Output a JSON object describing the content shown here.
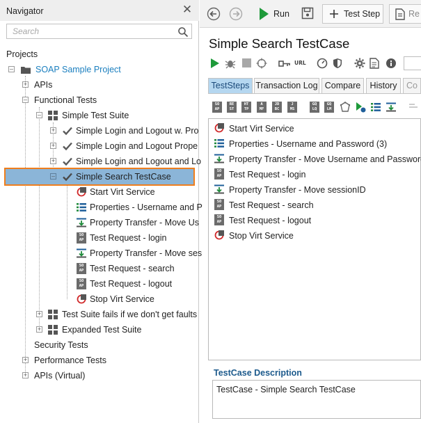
{
  "navigator": {
    "title": "Navigator",
    "search_placeholder": "Search",
    "projects_label": "Projects",
    "tree": [
      {
        "label": "SOAP Sample Project"
      },
      {
        "label": "APIs"
      },
      {
        "label": "Functional Tests"
      },
      {
        "label": "Simple Test Suite"
      },
      {
        "label": "Simple Login and Logout w. Pro"
      },
      {
        "label": "Simple Login and Logout Prope"
      },
      {
        "label": "Simple Login and Logout and Lo"
      },
      {
        "label": "Simple Search TestCase"
      },
      {
        "label": "Start Virt Service"
      },
      {
        "label": "Properties - Username and P"
      },
      {
        "label": "Property Transfer - Move Us"
      },
      {
        "label": "Test Request - login"
      },
      {
        "label": "Property Transfer - Move ses"
      },
      {
        "label": "Test Request - search"
      },
      {
        "label": "Test Request - logout"
      },
      {
        "label": "Stop Virt Service"
      },
      {
        "label": "Test Suite fails if we don't get faults"
      },
      {
        "label": "Expanded Test Suite"
      },
      {
        "label": "Security Tests"
      },
      {
        "label": "Performance Tests"
      },
      {
        "label": "APIs (Virtual)"
      }
    ]
  },
  "toolbar": {
    "run_label": "Run",
    "add_step_label": "Test Step",
    "report_label": "Re"
  },
  "testcase": {
    "title": "Simple Search TestCase",
    "url_icon_label": "URL",
    "tabs": [
      {
        "label": "TestSteps"
      },
      {
        "label": "Transaction Log"
      },
      {
        "label": "Compare"
      },
      {
        "label": "History"
      },
      {
        "label": "Co"
      }
    ],
    "steps": [
      {
        "label": "Start Virt Service"
      },
      {
        "label": "Properties - Username and Password (3)"
      },
      {
        "label": "Property Transfer - Move Username and Password"
      },
      {
        "label": "Test Request - login"
      },
      {
        "label": "Property Transfer - Move sessionID"
      },
      {
        "label": "Test Request - search"
      },
      {
        "label": "Test Request - logout"
      },
      {
        "label": "Stop Virt Service"
      }
    ],
    "steps_toolbar_icons": [
      {
        "top": "SO",
        "bottom": "AP"
      },
      {
        "top": "RE",
        "bottom": "ST"
      },
      {
        "top": "HT",
        "bottom": "TP"
      },
      {
        "top": "A",
        "bottom": "MF"
      },
      {
        "top": "JD",
        "bottom": "BC"
      },
      {
        "top": "J",
        "bottom": "MS"
      },
      {
        "top": "GQ",
        "bottom": "LQ"
      },
      {
        "top": "GQ",
        "bottom": "LM"
      }
    ],
    "description_title": "TestCase Description",
    "description_text": "TestCase - Simple Search TestCase"
  },
  "colors": {
    "accent_green": "#1e9a3a",
    "selection_blue": "#8bb5d8",
    "selection_outline": "#ef7e1d",
    "active_tab": "#b5d7f0"
  }
}
